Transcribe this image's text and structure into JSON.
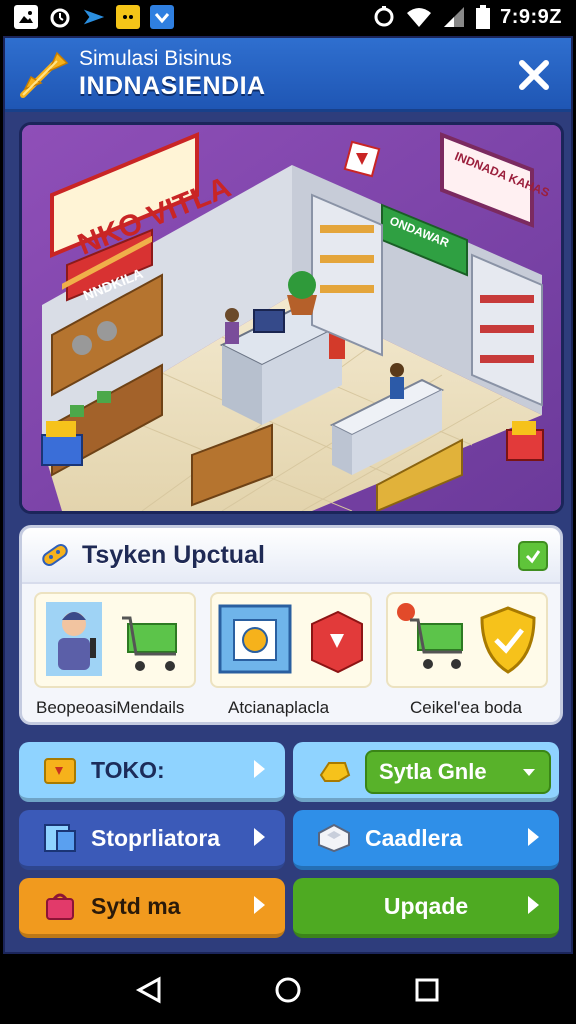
{
  "status_bar": {
    "time": "7:9:9Z",
    "icons": [
      "gallery-icon",
      "alarm-icon",
      "bird-icon",
      "cat-icon",
      "download-icon"
    ],
    "right_icons": [
      "alarm-icon",
      "wifi-icon",
      "signal-icon",
      "battery-icon"
    ]
  },
  "header": {
    "subtitle": "Simulasi Bisinus",
    "title": "INDNASIENDIA",
    "close_icon": "close-icon"
  },
  "scene": {
    "sign_main": "NKO VITLA",
    "sign_sub": "NNDKILA",
    "sign_green": "ONDAWAR",
    "sign_right": "INDNADA KAHAS",
    "sign_right_icon": "tag-icon"
  },
  "upgrade_panel": {
    "title": "Tsyken Upctual",
    "title_icon": "bandage-icon",
    "check_icon": "check-icon",
    "cards": [
      {
        "label": "BeopeoasiMendails"
      },
      {
        "label": "Atcianaplacla"
      },
      {
        "label": "Ceikel'ea boda"
      }
    ]
  },
  "buttons": {
    "toko": {
      "label": "TOKO:",
      "color": "#8fd3ff"
    },
    "sytla": {
      "label": "Sytla Gnle",
      "color": "#8fd3ff"
    },
    "stor": {
      "label": "Stoprliatora",
      "color": "#3b5ab8"
    },
    "cadera": {
      "label": "Caadlera",
      "color": "#2f8fe8"
    },
    "sytdma": {
      "label": "Sytd ma",
      "color": "#f19a1e"
    },
    "upgrade": {
      "label": "Upqade",
      "color": "#4eaa22"
    }
  },
  "navbar": {
    "back_icon": "back-icon",
    "home_icon": "home-icon",
    "recents_icon": "recents-icon"
  }
}
